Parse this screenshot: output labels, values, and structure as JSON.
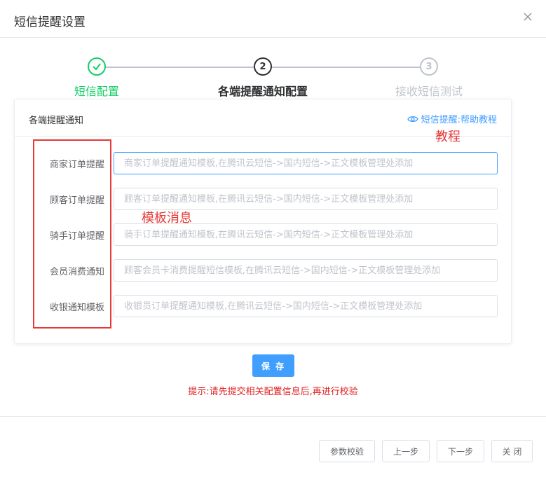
{
  "dialog": {
    "title": "短信提醒设置"
  },
  "steps": [
    {
      "number": "1",
      "label": "短信配置",
      "state": "done"
    },
    {
      "number": "2",
      "label": "各端提醒通知配置",
      "state": "active"
    },
    {
      "number": "3",
      "label": "接收短信测试",
      "state": "pending"
    }
  ],
  "card": {
    "title": "各端提醒通知",
    "help_link": "短信提醒:帮助教程"
  },
  "fields": [
    {
      "label": "商家订单提醒",
      "value": "",
      "placeholder": "商家订单提醒通知模板,在腾讯云短信->国内短信->正文模板管理处添加"
    },
    {
      "label": "顾客订单提醒",
      "value": "",
      "placeholder": "顾客订单提醒通知模板,在腾讯云短信->国内短信->正文模板管理处添加"
    },
    {
      "label": "骑手订单提醒",
      "value": "",
      "placeholder": "骑手订单提醒通知模板,在腾讯云短信->国内短信->正文模板管理处添加"
    },
    {
      "label": "会员消费通知",
      "value": "",
      "placeholder": "顾客会员卡消费提醒短信模板,在腾讯云短信->国内短信->正文模板管理处添加"
    },
    {
      "label": "收银通知模板",
      "value": "",
      "placeholder": "收银员订单提醒通知模板,在腾讯云短信->国内短信->正文模板管理处添加"
    }
  ],
  "annotations": {
    "tutorial": "教程",
    "template_message": "模板消息"
  },
  "save_label": "保 存",
  "hint": "提示:请先提交相关配置信息后,再进行校验",
  "footer": {
    "verify_label": "参数校验",
    "prev_label": "上一步",
    "next_label": "下一步",
    "close_label": "关 闭"
  },
  "colors": {
    "done": "#13ce66",
    "active": "#303133",
    "pending": "#c0c4cc",
    "primary": "#409eff",
    "annotation": "#e53935"
  }
}
